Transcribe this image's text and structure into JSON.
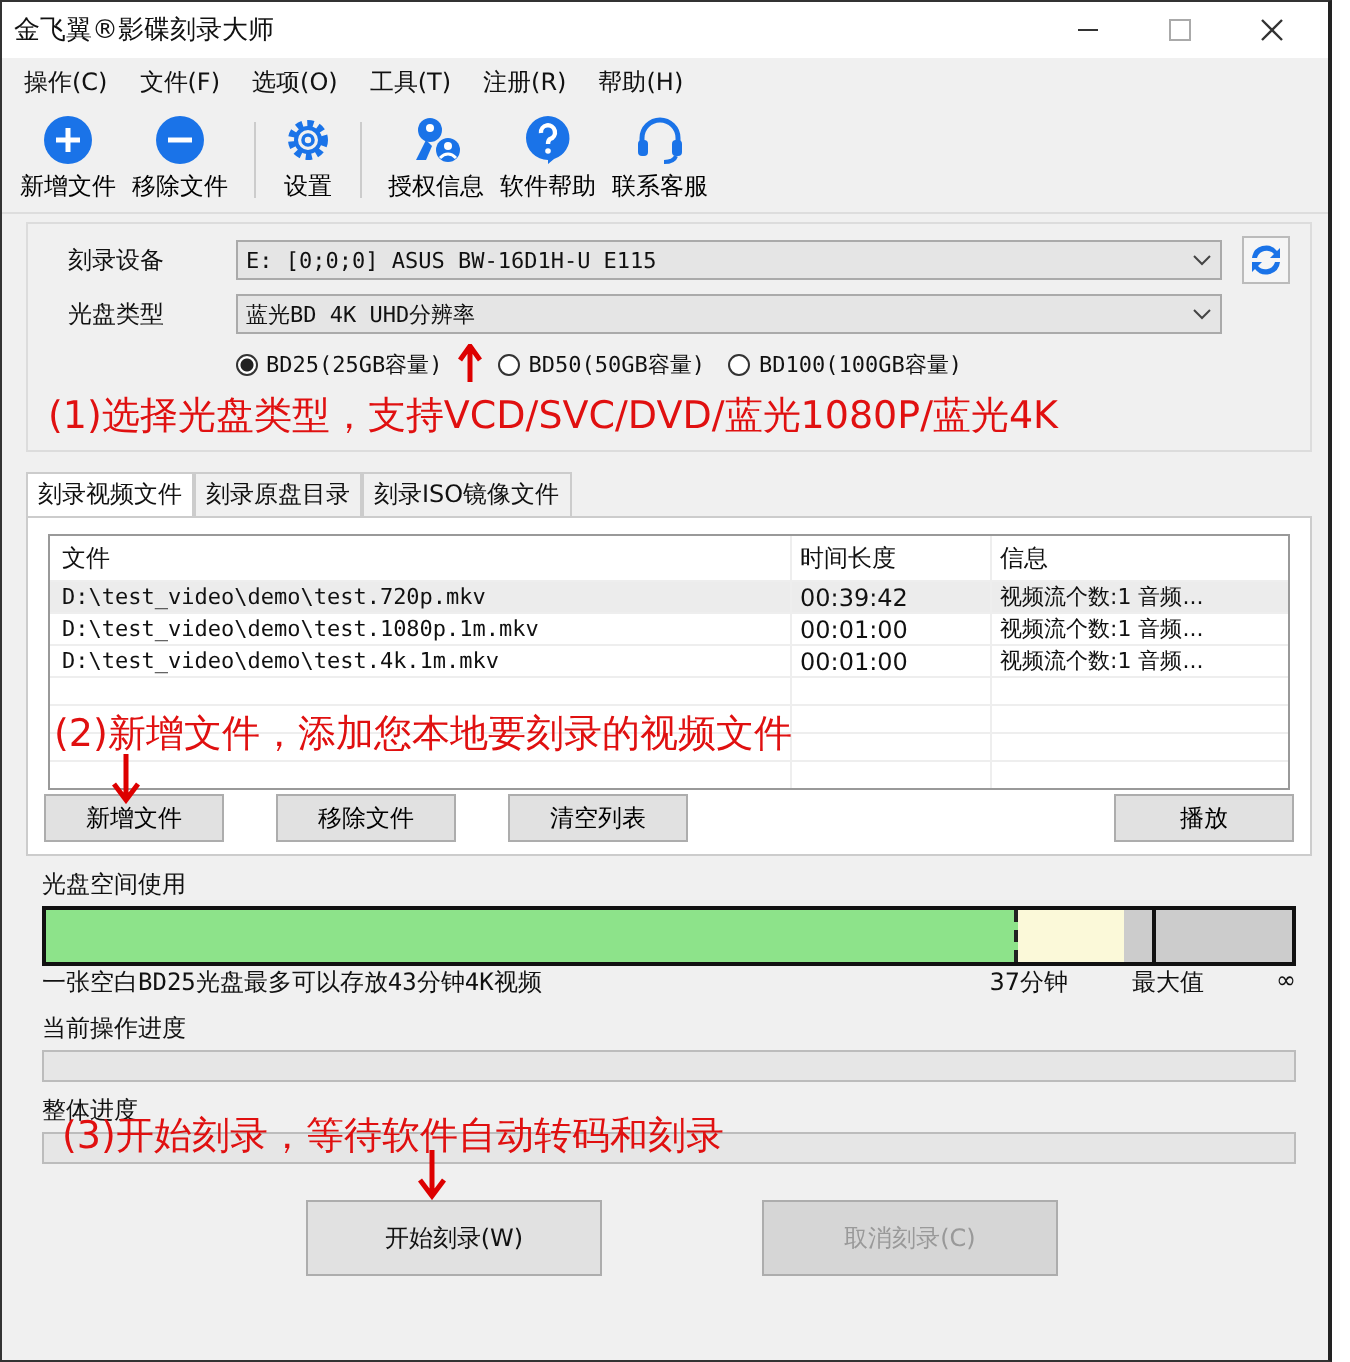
{
  "window": {
    "title": "金飞翼®影碟刻录大师"
  },
  "menu": [
    "操作(C)",
    "文件(F)",
    "选项(O)",
    "工具(T)",
    "注册(R)",
    "帮助(H)"
  ],
  "toolbar": [
    [
      {
        "kind": "plus",
        "label": "新增文件"
      },
      {
        "kind": "minus",
        "label": "移除文件"
      }
    ],
    [
      {
        "kind": "gear",
        "label": "设置"
      }
    ],
    [
      {
        "kind": "key",
        "label": "授权信息"
      },
      {
        "kind": "help",
        "label": "软件帮助"
      },
      {
        "kind": "headset",
        "label": "联系客服"
      }
    ]
  ],
  "device": {
    "label": "刻录设备",
    "value": "E:  [0;0;0] ASUS BW-16D1H-U E115"
  },
  "disc_type": {
    "label": "光盘类型",
    "value": "蓝光BD 4K UHD分辨率"
  },
  "capacities": [
    {
      "label": "BD25(25GB容量)",
      "selected": true
    },
    {
      "label": "BD50(50GB容量)",
      "selected": false
    },
    {
      "label": "BD100(100GB容量)",
      "selected": false
    }
  ],
  "note_1": "(1)选择光盘类型，支持VCD/SVC/DVD/蓝光1080P/蓝光4K",
  "tabs": [
    {
      "label": "刻录视频文件",
      "selected": true
    },
    {
      "label": "刻录原盘目录",
      "selected": false
    },
    {
      "label": "刻录ISO镜像文件",
      "selected": false
    }
  ],
  "table": {
    "columns": [
      "文件",
      "时间长度",
      "信息"
    ],
    "rows": [
      {
        "file": "D:\\test_video\\demo\\test.720p.mkv",
        "duration": "00:39:42",
        "info": "视频流个数:1 音频...",
        "selected": true
      },
      {
        "file": "D:\\test_video\\demo\\test.1080p.1m.mkv",
        "duration": "00:01:00",
        "info": "视频流个数:1 音频...",
        "selected": false
      },
      {
        "file": "D:\\test_video\\demo\\test.4k.1m.mkv",
        "duration": "00:01:00",
        "info": "视频流个数:1 音频...",
        "selected": false
      }
    ]
  },
  "note_2": "(2)新增文件，添加您本地要刻录的视频文件",
  "list_buttons": [
    "新增文件",
    "移除文件",
    "清空列表"
  ],
  "play_button": "播放",
  "disc_space": {
    "label": "光盘空间使用",
    "level": 0.78,
    "caption": "一张空白BD25光盘最多可以存放43分钟4K视频",
    "marker": "37分钟",
    "max_label": "最大值",
    "end_label": "∞"
  },
  "current_progress": {
    "label": "当前操作进度"
  },
  "overall_progress": {
    "label": "整体进度"
  },
  "note_3": "(3)开始刻录，等待软件自动转码和刻录",
  "actions": [
    {
      "label": "开始刻录(W)",
      "disabled": false
    },
    {
      "label": "取消刻录(C)",
      "disabled": true
    }
  ]
}
